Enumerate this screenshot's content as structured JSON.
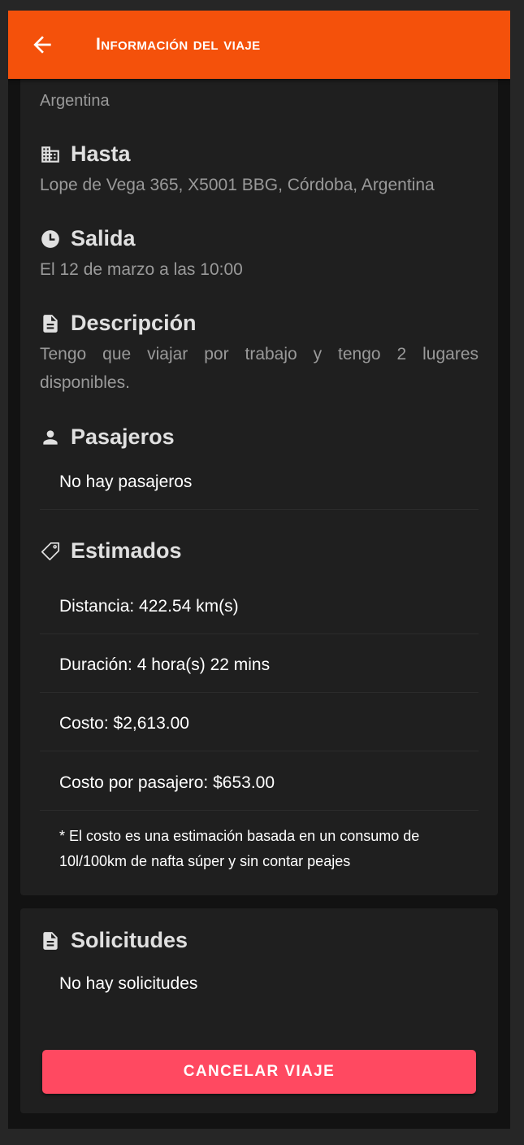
{
  "header": {
    "title": "Información del viaje",
    "back_icon": "arrow-left-icon"
  },
  "colors": {
    "header": "#f4510b",
    "danger": "#ff4961",
    "card": "#1f1f1f",
    "background": "#121212"
  },
  "trip": {
    "from_tail": "Argentina",
    "to": {
      "label": "Hasta",
      "value": "Lope de Vega 365, X5001 BBG, Córdoba, Argentina",
      "icon": "building-icon"
    },
    "departure": {
      "label": "Salida",
      "value": "El 12 de marzo a las 10:00",
      "icon": "clock-icon"
    },
    "description": {
      "label": "Descripción",
      "value": "Tengo que viajar por trabajo y tengo 2 lugares disponibles.",
      "icon": "document-icon"
    },
    "passengers": {
      "label": "Pasajeros",
      "empty": "No hay pasajeros",
      "icon": "person-icon"
    },
    "estimates": {
      "label": "Estimados",
      "icon": "tag-icon",
      "distance": "Distancia: 422.54 km(s)",
      "duration": "Duración: 4 hora(s) 22 mins",
      "cost": "Costo: $2,613.00",
      "cost_per_passenger": "Costo por pasajero: $653.00",
      "note": "* El costo es una estimación basada en un consumo de 10l/100km de nafta súper y sin contar peajes"
    }
  },
  "requests": {
    "label": "Solicitudes",
    "empty": "No hay solicitudes",
    "icon": "document-icon"
  },
  "actions": {
    "cancel": "CANCELAR VIAJE"
  }
}
